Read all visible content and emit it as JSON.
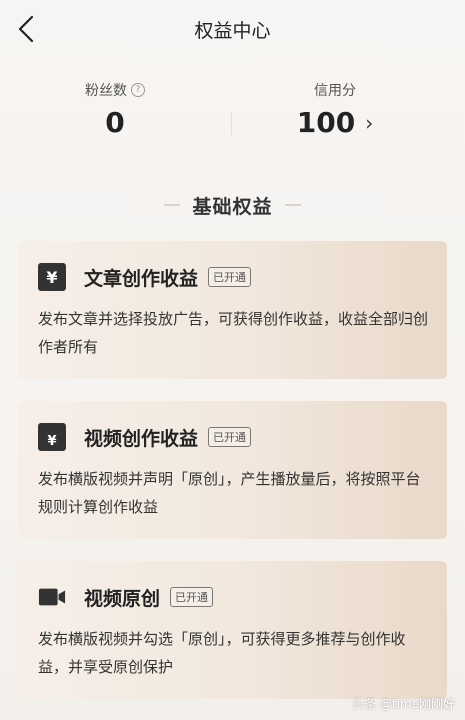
{
  "header": {
    "title": "权益中心"
  },
  "stats": {
    "fans": {
      "label": "粉丝数",
      "value": "0"
    },
    "credit": {
      "label": "信用分",
      "value": "100"
    }
  },
  "section": {
    "title": "基础权益"
  },
  "cards": [
    {
      "icon": "yen-icon",
      "title": "文章创作收益",
      "status": "已开通",
      "desc": "发布文章并选择投放广告，可获得创作收益，收益全部归创作者所有"
    },
    {
      "icon": "tv-icon",
      "title": "视频创作收益",
      "status": "已开通",
      "desc": "发布横版视频并声明「原创」，产生播放量后，将按照平台规则计算创作收益"
    },
    {
      "icon": "video-camera-icon",
      "title": "视频原创",
      "status": "已开通",
      "desc": "发布横版视频并勾选「原创」，可获得更多推荐与创作收益，并享受原创保护"
    }
  ],
  "watermark": {
    "text": "头条 @time刚刚好"
  },
  "colors": {
    "card_start": "#f6efe8",
    "card_end": "#e9d9c9",
    "icon_bg": "#333333"
  }
}
